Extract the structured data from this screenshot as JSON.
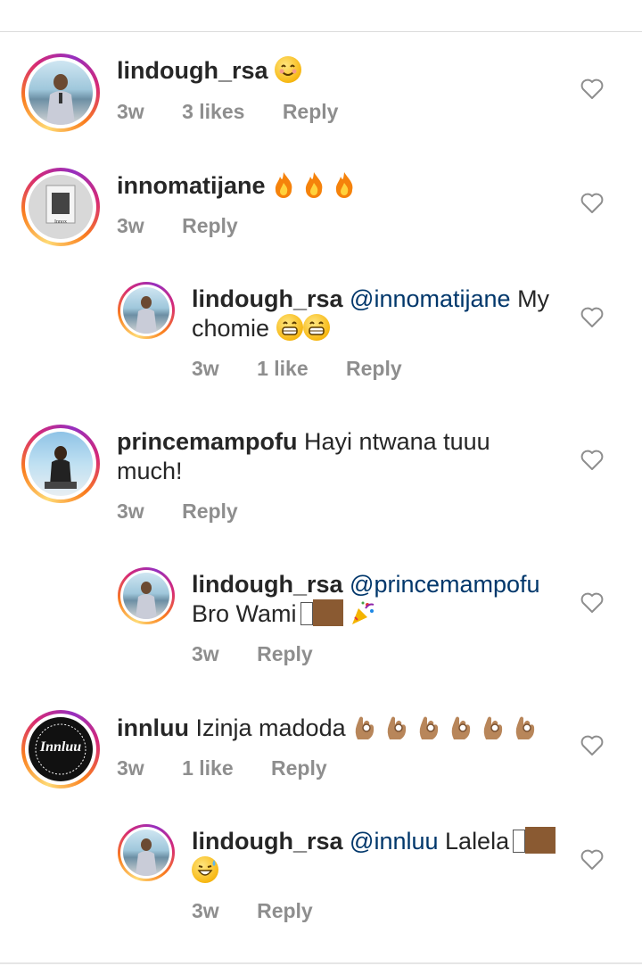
{
  "comments": [
    {
      "username": "lindough_rsa",
      "mention": "",
      "text": "",
      "time": "3w",
      "likes": "3 likes",
      "reply": "Reply",
      "emoji": "smiling-face"
    },
    {
      "username": "innomatijane",
      "mention": "",
      "text": "",
      "time": "3w",
      "likes": "",
      "reply": "Reply",
      "emoji": "fire x3"
    },
    {
      "username": "lindough_rsa",
      "mention": "@innomatijane",
      "text": "My",
      "text2": "chomie",
      "time": "3w",
      "likes": "1 like",
      "reply": "Reply",
      "emoji": "grinning x2"
    },
    {
      "username": "princemampofu",
      "mention": "",
      "text": "Hayi ntwana tuuu",
      "text2": "much!",
      "time": "3w",
      "likes": "",
      "reply": "Reply"
    },
    {
      "username": "lindough_rsa",
      "mention": "@princemampofu",
      "text": "",
      "text2": "Bro Wami",
      "time": "3w",
      "likes": "",
      "reply": "Reply",
      "emoji": "skin-tone party-popper"
    },
    {
      "username": "innluu",
      "mention": "",
      "text": "Izinja madoda",
      "time": "3w",
      "likes": "1 like",
      "reply": "Reply",
      "emoji": "ok-hand x6"
    },
    {
      "username": "lindough_rsa",
      "mention": "@innluu",
      "text": "Lalela",
      "time": "3w",
      "likes": "",
      "reply": "Reply",
      "emoji": "skin-tone sweat-smile"
    }
  ],
  "avatars": {
    "innluu_logo_text": "Innluu"
  },
  "colors": {
    "mention": "#00376b",
    "meta": "#8e8e8e",
    "divider": "#dbdbdb"
  },
  "icons": [
    "heart-icon",
    "smiling-face-icon",
    "fire-icon",
    "grinning-face-icon",
    "party-popper-icon",
    "ok-hand-icon",
    "sweat-smile-icon"
  ]
}
